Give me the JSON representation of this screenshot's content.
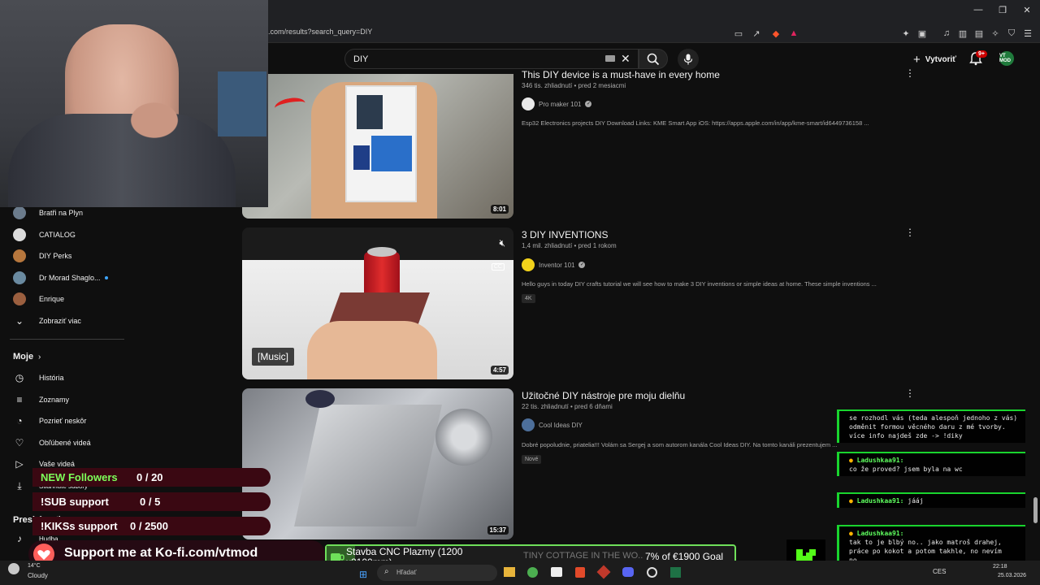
{
  "browser": {
    "url": ".com/results?search_query=DIY",
    "window_controls": [
      "minimize-icon",
      "maximize-icon",
      "close-icon"
    ]
  },
  "youtube_header": {
    "search_value": "DIY",
    "create_label": "Vytvoriť",
    "notification_count": "9+",
    "avatar_text": "VT MOD"
  },
  "sidebar": {
    "subscriptions": [
      {
        "label": "Bratři na Plyn",
        "color": "#6b7b8c"
      },
      {
        "label": "CATIALOG",
        "color": "#dcdcdc"
      },
      {
        "label": "DIY Perks",
        "color": "#b7773d"
      },
      {
        "label": "Dr Morad Shaglo...",
        "color": "#6a8aa0",
        "new": true
      },
      {
        "label": "Enrique",
        "color": "#9b5f3f"
      }
    ],
    "show_more": "Zobraziť viac",
    "you_heading": "Moje",
    "you_items": [
      {
        "label": "História",
        "icon": "history-icon"
      },
      {
        "label": "Zoznamy",
        "icon": "playlists-icon"
      },
      {
        "label": "Pozrieť neskôr",
        "icon": "watch-later-icon"
      },
      {
        "label": "Obľúbené videá",
        "icon": "liked-icon"
      },
      {
        "label": "Vaše videá",
        "icon": "your-videos-icon"
      },
      {
        "label": "Stiahnuté súbory",
        "icon": "downloads-icon"
      }
    ],
    "explore_heading": "Preskúmať",
    "explore_items": [
      {
        "label": "Hudba",
        "icon": "music-icon"
      }
    ]
  },
  "videos": [
    {
      "title": "This DIY device is a must-have in every home",
      "meta": "346 tis. zhliadnutí • pred 2 mesiacmi",
      "channel": "Pro maker 101",
      "verified": true,
      "description": "Esp32 Electronics projects DIY Download Links: KME Smart App iOS: https://apps.apple.com/in/app/kme-smart/id6449736158 ...",
      "duration": "8:01",
      "badge": ""
    },
    {
      "title": "3 DIY INVENTIONS",
      "meta": "1,4 mil. zhliadnutí • pred 1 rokom",
      "channel": "Inventor 101",
      "verified": true,
      "description": "Hello guys in today DIY crafts tutorial we will see how to make 3 DIY inventions or simple ideas at home. These simple inventions ...",
      "duration": "4:57",
      "badge": "4K",
      "caption": "[Music]"
    },
    {
      "title": "Užitočné DIY nástroje pre moju dielňu",
      "meta": "22 tis. zhliadnutí • pred 6 dňami",
      "channel": "Cool Ideas DIY",
      "verified": false,
      "description": "Dobré popoludnie, priatelia!!! Volám sa Sergej a som autorom kanála Cool Ideas DIY. Na tomto kanáli prezentujem ...",
      "duration": "15:37",
      "badge": "Nové"
    }
  ],
  "stream_overlay": {
    "goals": [
      {
        "name": "NEW Followers",
        "value": "0 / 20",
        "name_color": "#7dff5a"
      },
      {
        "name": "!SUB support",
        "value": "0 / 5",
        "name_color": "#ffffff"
      },
      {
        "name": "!KIKSs support",
        "value": "0 / 2500",
        "name_color": "#ffffff"
      }
    ],
    "kofi": "Support me at Ko-fi.com/vtmod",
    "goal_pill": {
      "title": "Stavba CNC Plazmy (1200 x2100mm)",
      "ticker": "TINY COTTAGE IN THE WO...",
      "progress_text": "7% of €1900 Goal",
      "progress": 0.07
    },
    "chat": [
      {
        "user": "",
        "text": "se rozhodl vás (teda alespoň jednoho z vás) odměnit formou věcného daru z mé tvorby. více info najdeš zde -> !diky"
      },
      {
        "user": "Ladushkaa91:",
        "text": "co že proved? jsem byla na wc"
      },
      {
        "user": "Ladushkaa91:",
        "text": "jááj"
      },
      {
        "user": "Ladushkaa91:",
        "text": "tak to je blbý no.. jako matroš drahej, práce po kokot a potom takhle, no nevím no.."
      }
    ]
  },
  "taskbar": {
    "weather_temp": "14°C",
    "weather_text": "Cloudy",
    "search_placeholder": "Hľadať",
    "lang": "CES",
    "time": "22:18",
    "date": "25.03.2026"
  }
}
